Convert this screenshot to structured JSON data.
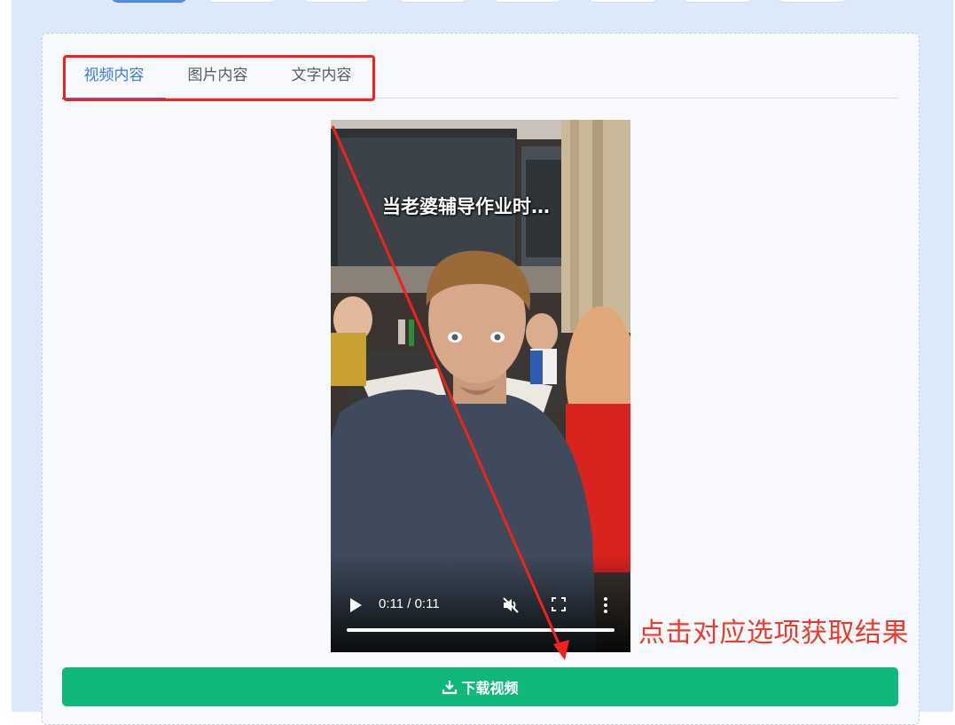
{
  "tabs": [
    {
      "label": "视频内容",
      "active": true
    },
    {
      "label": "图片内容",
      "active": false
    },
    {
      "label": "文字内容",
      "active": false
    }
  ],
  "video": {
    "caption": "当老婆辅导作业时…",
    "time": "0:11 / 0:11",
    "progress": 1.0,
    "muted": true,
    "icons": [
      "play-icon",
      "muted-volume-icon",
      "fullscreen-icon",
      "more-vert-icon"
    ]
  },
  "annotation": "点击对应选项获取结果",
  "download": {
    "label": "下载视频",
    "icon": "download-icon"
  },
  "colors": {
    "accent": "#3a7be0",
    "download_button": "#12b87b",
    "annotation": "#ee3a2d",
    "highlight_border": "#f0221b",
    "page_background": "#dce9fb"
  }
}
